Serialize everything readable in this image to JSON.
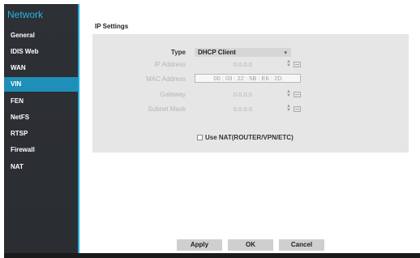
{
  "sidebar": {
    "title": "Network",
    "items": [
      {
        "label": "General"
      },
      {
        "label": "IDIS Web"
      },
      {
        "label": "WAN"
      },
      {
        "label": "VIN"
      },
      {
        "label": "FEN"
      },
      {
        "label": "NetFS"
      },
      {
        "label": "RTSP"
      },
      {
        "label": "Firewall"
      },
      {
        "label": "NAT"
      }
    ],
    "active_item": "VIN"
  },
  "main": {
    "section_title": "IP Settings",
    "type_label": "Type",
    "type_value": "DHCP Client",
    "ip_address_label": "IP Address",
    "ip_address_value": "0.0.0.0",
    "mac_address_label": "MAC Address",
    "mac_address_value": "00 : 03 : 22 : 5B : E6 : 2D",
    "gateway_label": "Gateway",
    "gateway_value": "0.0.0.0",
    "subnet_mask_label": "Subnet Mask",
    "subnet_mask_value": "0.0.0.0",
    "nat_checkbox_label": "Use NAT(ROUTER/VPN/ETC)",
    "nat_checked": false
  },
  "footer": {
    "apply_label": "Apply",
    "ok_label": "OK",
    "cancel_label": "Cancel"
  },
  "colors": {
    "accent": "#1aa9dc",
    "active_item_bg": "#1e8fb8",
    "sidebar_bg": "#2d3034",
    "panel_bg": "#e6e6e6"
  }
}
